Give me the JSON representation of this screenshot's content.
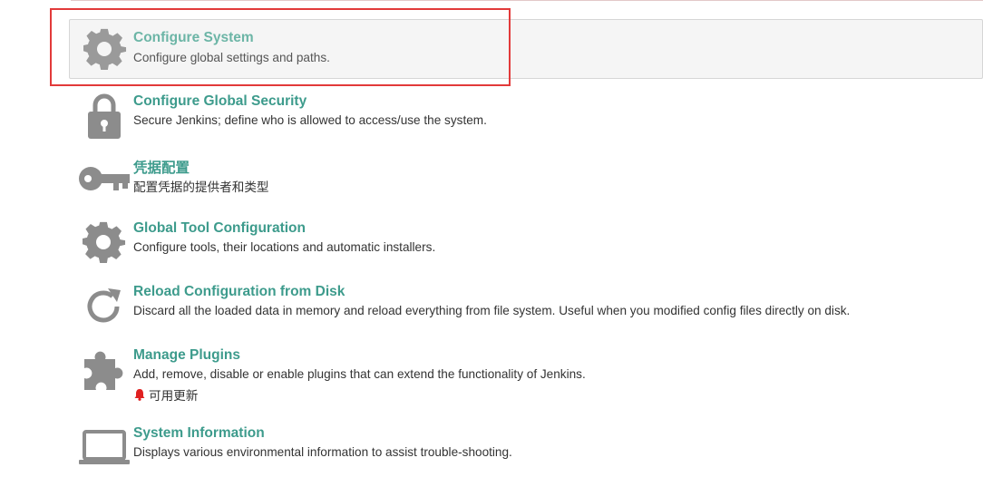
{
  "items": [
    {
      "id": "configure-system",
      "title": "Configure System",
      "desc": "Configure global settings and paths.",
      "icon": "gear-icon"
    },
    {
      "id": "configure-global-security",
      "title": "Configure Global Security",
      "desc": "Secure Jenkins; define who is allowed to access/use the system.",
      "icon": "lock-icon"
    },
    {
      "id": "credentials-config",
      "title": "凭据配置",
      "desc": "配置凭据的提供者和类型",
      "icon": "key-icon"
    },
    {
      "id": "global-tool-configuration",
      "title": "Global Tool Configuration",
      "desc": "Configure tools, their locations and automatic installers.",
      "icon": "gear-icon"
    },
    {
      "id": "reload-configuration",
      "title": "Reload Configuration from Disk",
      "desc": "Discard all the loaded data in memory and reload everything from file system. Useful when you modified config files directly on disk.",
      "icon": "reload-icon"
    },
    {
      "id": "manage-plugins",
      "title": "Manage Plugins",
      "desc": "Add, remove, disable or enable plugins that can extend the functionality of Jenkins.",
      "icon": "puzzle-icon",
      "notice": "可用更新",
      "notice_icon": "bell-icon"
    },
    {
      "id": "system-information",
      "title": "System Information",
      "desc": "Displays various environmental information to assist trouble-shooting.",
      "icon": "laptop-icon"
    }
  ],
  "colors": {
    "link": "#3d9b8c",
    "icon": "#8c8c8c",
    "highlight": "#e23a3a",
    "bell": "#e02020"
  }
}
